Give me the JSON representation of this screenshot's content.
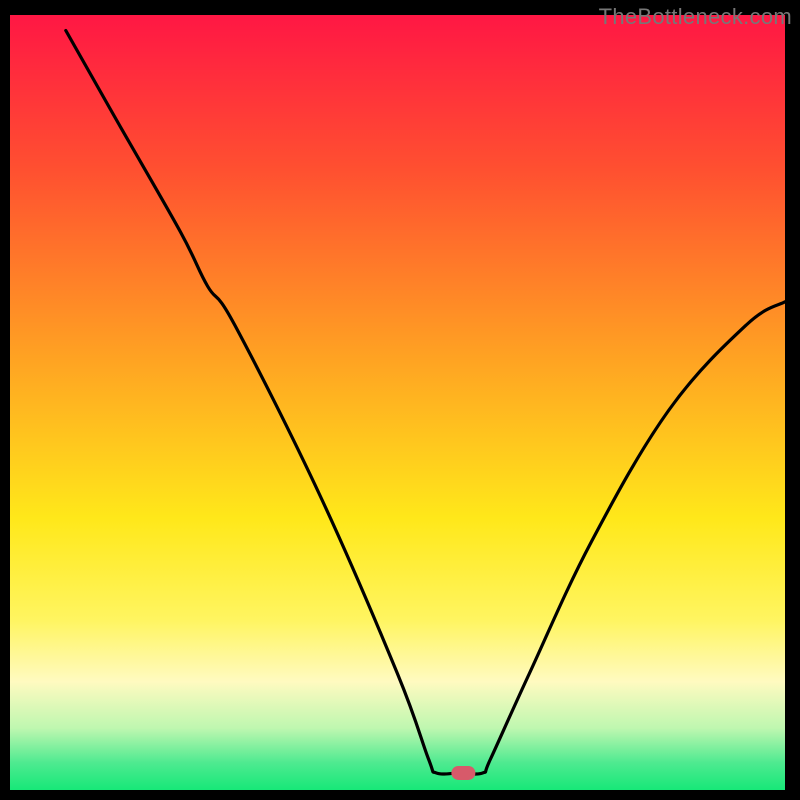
{
  "watermark": "TheBottleneck.com",
  "chart_data": {
    "type": "line",
    "title": "",
    "xlabel": "",
    "ylabel": "",
    "xlim": [
      0,
      100
    ],
    "ylim": [
      0,
      100
    ],
    "background_gradient": [
      {
        "stop": 0.0,
        "color": "#ff1744"
      },
      {
        "stop": 0.2,
        "color": "#ff5030"
      },
      {
        "stop": 0.45,
        "color": "#ffa522"
      },
      {
        "stop": 0.65,
        "color": "#ffe81a"
      },
      {
        "stop": 0.78,
        "color": "#fff560"
      },
      {
        "stop": 0.86,
        "color": "#fffac0"
      },
      {
        "stop": 0.92,
        "color": "#bff7b0"
      },
      {
        "stop": 0.965,
        "color": "#4eea90"
      },
      {
        "stop": 1.0,
        "color": "#17e878"
      }
    ],
    "series": [
      {
        "name": "bottleneck-curve",
        "points": [
          {
            "x": 7.2,
            "y": 98.0
          },
          {
            "x": 14.0,
            "y": 86.0
          },
          {
            "x": 22.0,
            "y": 72.0
          },
          {
            "x": 25.5,
            "y": 65.0
          },
          {
            "x": 29.0,
            "y": 60.0
          },
          {
            "x": 40.0,
            "y": 38.0
          },
          {
            "x": 50.0,
            "y": 15.0
          },
          {
            "x": 54.0,
            "y": 4.0
          },
          {
            "x": 55.0,
            "y": 2.2
          },
          {
            "x": 58.0,
            "y": 2.2
          },
          {
            "x": 61.0,
            "y": 2.2
          },
          {
            "x": 62.0,
            "y": 4.0
          },
          {
            "x": 67.0,
            "y": 15.0
          },
          {
            "x": 75.0,
            "y": 32.0
          },
          {
            "x": 85.0,
            "y": 49.0
          },
          {
            "x": 95.0,
            "y": 60.0
          },
          {
            "x": 100.0,
            "y": 63.0
          }
        ]
      }
    ],
    "marker": {
      "x": 58.5,
      "y": 2.2,
      "color": "#d75a6a"
    },
    "frame": {
      "top_width": 15,
      "bottom_width": 10,
      "left_width": 10,
      "right_width": 15,
      "color": "#000000"
    }
  }
}
